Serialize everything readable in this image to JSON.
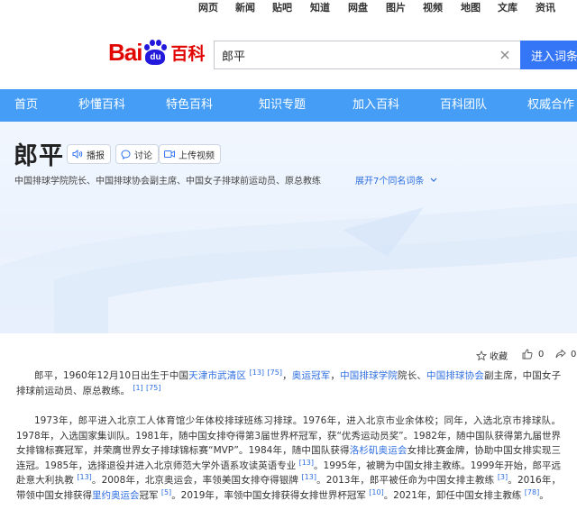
{
  "top_links": [
    "网页",
    "新闻",
    "贴吧",
    "知道",
    "网盘",
    "图片",
    "视频",
    "地图",
    "文库",
    "资讯"
  ],
  "logo": {
    "bai": "Bai",
    "du": "du",
    "baike": "百科"
  },
  "search": {
    "value": "郎平",
    "button": "进入词条"
  },
  "nav": [
    "首页",
    "秒懂百科",
    "特色百科",
    "知识专题",
    "加入百科",
    "百科团队",
    "权威合作"
  ],
  "entry": {
    "title": "郎平",
    "pills": {
      "play": "播报",
      "discuss": "讨论",
      "upload": "上传视频"
    },
    "subtitle": "中国排球学院院长、中国排球协会副主席、中国女子排球前运动员、原总教练",
    "expand": "展开7个同名词条"
  },
  "actions": {
    "collect": "收藏",
    "like_count": "0",
    "share_count": "0"
  },
  "paragraphs": {
    "p1": {
      "a": "郎平，1960年12月10日出生于中国",
      "link1": "天津市武清区",
      "ref1": "[13]",
      "ref2": "[75]",
      "b": "，",
      "link2": "奥运冠军",
      "c": "，",
      "link3": "中国排球学院",
      "d": "院长、",
      "link4": "中国排球协会",
      "e": "副主席，中国女子排球前运动员、原总教练。",
      "ref3": "[1]",
      "ref4": "[75]"
    },
    "p2": {
      "a": "1973年，郎平进入北京工人体育馆少年体校排球班练习排球。1976年，进入北京市业余体校；同年，入选北京市排球队。1978年，入选国家集训队。1981年，随中国女排夺得第3届世界杯冠军，获“优秀运动员奖”。1982年，随中国队获得第九届世界女排锦标赛冠军，并荣膺世界女子排球锦标赛“MVP”。1984年，随中国队获得",
      "link1": "洛杉矶奥运会",
      "b": "女排比赛金牌，协助中国女排实现三连冠。1985年，选择退役并进入北京师范大学外语系攻读英语专业",
      "ref1": "[13]",
      "c": "。1995年，被聘为中国女排主教练。1999年开始，郎平远赴意大利执教",
      "ref2": "[13]",
      "d": "。2008年，北京奥运会，率领美国女排夺得银牌",
      "ref3": "[13]",
      "e": "。2013年，郎平被任命为中国女排主教练",
      "ref4": "[3]",
      "f": "。2016年，带领中国女排获得",
      "link2": "里约奥运会",
      "g": "冠军",
      "ref5": "[5]",
      "h": "。2019年，率领中国女排获得女排世界杯冠军",
      "ref6": "[10]",
      "i": "。2021年，卸任中国女排主教练",
      "ref7": "[78]",
      "j": "。"
    }
  }
}
